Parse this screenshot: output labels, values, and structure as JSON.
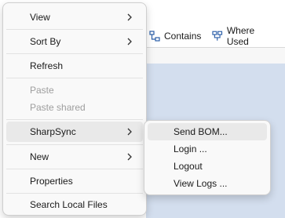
{
  "background": {
    "toolbar": {
      "contains_label": "Contains",
      "where_used_label": "Where Used"
    }
  },
  "context_menu": {
    "items": [
      {
        "label": "View",
        "submenu": true
      },
      {
        "label": "Sort By",
        "submenu": true
      },
      {
        "label": "Refresh"
      },
      {
        "label": "Paste",
        "disabled": true
      },
      {
        "label": "Paste shared",
        "disabled": true
      },
      {
        "label": "SharpSync",
        "submenu": true,
        "highlighted": true
      },
      {
        "label": "New",
        "submenu": true
      },
      {
        "label": "Properties"
      },
      {
        "label": "Search Local Files"
      }
    ]
  },
  "sharpsync_submenu": {
    "items": [
      {
        "label": "Send BOM...",
        "highlighted": true
      },
      {
        "label": "Login ..."
      },
      {
        "label": "Logout"
      },
      {
        "label": "View Logs ..."
      }
    ]
  },
  "colors": {
    "menu_bg": "#f9f9f9",
    "hover_bg": "#e9e9e9",
    "disabled_text": "#9e9e9e",
    "panel_blue": "#d3deee"
  },
  "icons": {
    "contains": "hierarchy-down-icon",
    "where_used": "hierarchy-up-icon",
    "submenu_arrow": "chevron-right-icon"
  }
}
